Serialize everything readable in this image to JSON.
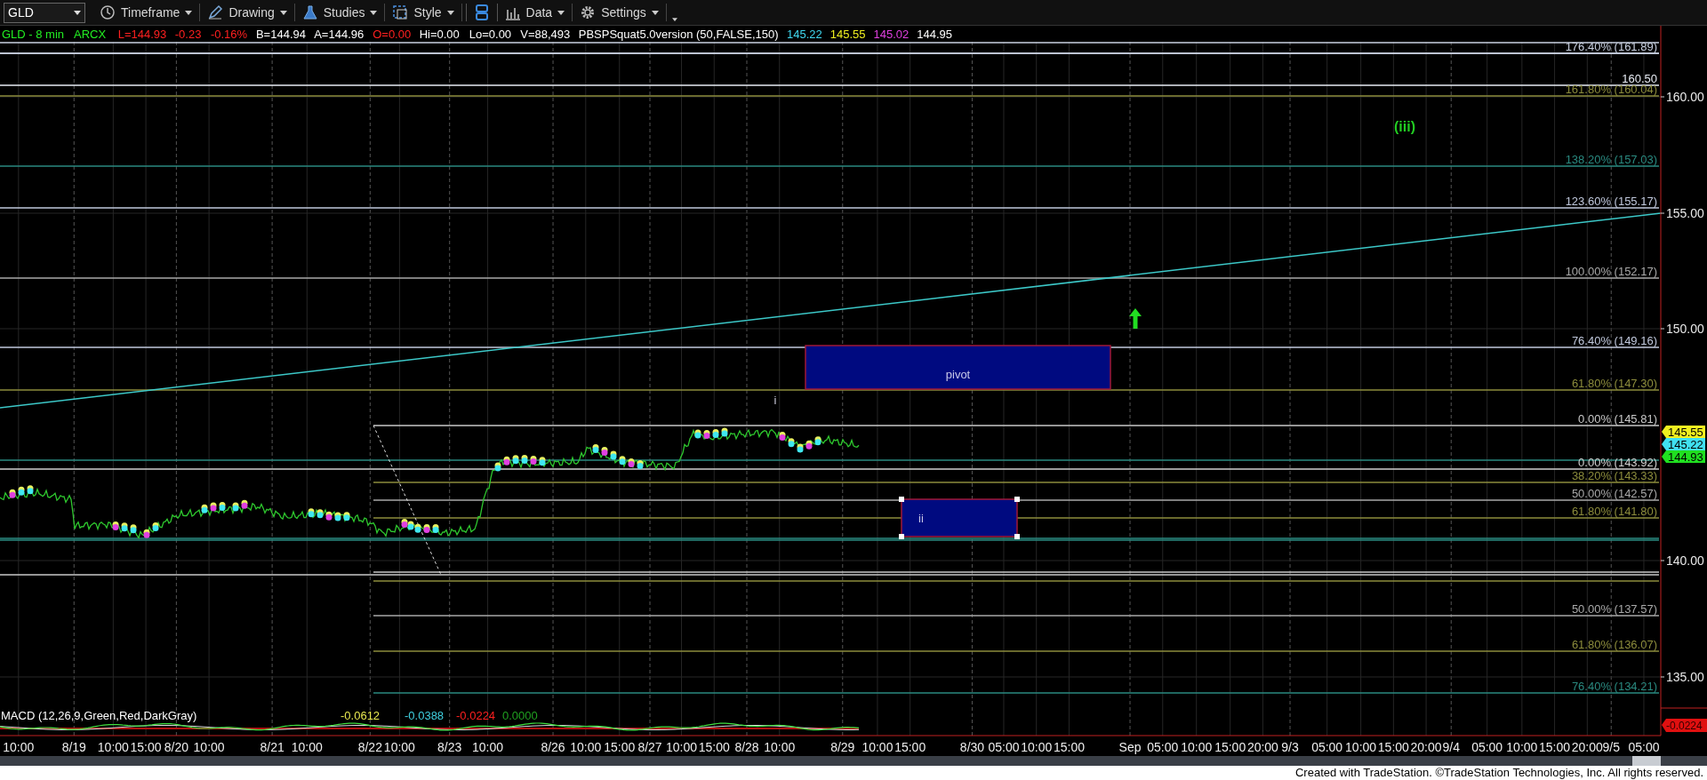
{
  "toolbar": {
    "symbol": "GLD",
    "buttons": [
      {
        "kind": "timeframe",
        "label": "Timeframe"
      },
      {
        "kind": "drawing",
        "label": "Drawing"
      },
      {
        "kind": "studies",
        "label": "Studies"
      },
      {
        "kind": "style",
        "label": "Style"
      },
      {
        "kind": "layout"
      },
      {
        "kind": "data",
        "label": "Data"
      },
      {
        "kind": "settings",
        "label": "Settings"
      },
      {
        "kind": "more"
      }
    ]
  },
  "info_line": [
    {
      "text": "GLD - 8 min",
      "color": "#22ee22"
    },
    {
      "text": "ARCX",
      "color": "#22ee22"
    },
    {
      "text": "L=144.93",
      "color": "#ff2020"
    },
    {
      "text": "-0.23",
      "color": "#ff2020"
    },
    {
      "text": "-0.16%",
      "color": "#ff2020"
    },
    {
      "text": "B=144.94",
      "color": "#ffffff"
    },
    {
      "text": "A=144.96",
      "color": "#ffffff"
    },
    {
      "text": "O=0.00",
      "color": "#ff2020"
    },
    {
      "text": "Hi=0.00",
      "color": "#ffffff"
    },
    {
      "text": "Lo=0.00",
      "color": "#ffffff"
    },
    {
      "text": "V=88,493",
      "color": "#ffffff"
    },
    {
      "text": "PBSPSquat5.0version (50,FALSE,150)",
      "color": "#ffffff"
    },
    {
      "text": "145.22",
      "color": "#40d8f0"
    },
    {
      "text": "145.55",
      "color": "#f0f020"
    },
    {
      "text": "145.02",
      "color": "#e040e0"
    },
    {
      "text": "144.95",
      "color": "#ffffff"
    }
  ],
  "fib_levels": [
    {
      "label": "176.40% (161.89)",
      "color": "#c8d0e0"
    },
    {
      "label": "160.50",
      "color": "#e8ecf4"
    },
    {
      "label": "161.80% (160.04)",
      "color": "#8c8c3c"
    },
    {
      "label": "138.20% (157.03)",
      "color": "#2a8a80"
    },
    {
      "label": "123.60% (155.17)",
      "color": "#c0c8dc"
    },
    {
      "label": "100.00% (152.17)",
      "color": "#a8a8a8"
    },
    {
      "label": "76.40% (149.16)",
      "color": "#c0c8dc"
    },
    {
      "label": "61.80% (147.30)",
      "color": "#8c8c3c"
    },
    {
      "label": "0.00% (145.81)",
      "color": "#c8c8c8"
    },
    {
      "label": "0.00% (143.92)",
      "color": "#d0d0d0"
    },
    {
      "label": "38.20% (143.33)",
      "color": "#8c8c3c"
    },
    {
      "label": "50.00% (142.57)",
      "color": "#a8a8a8"
    },
    {
      "label": "61.80% (141.80)",
      "color": "#8c8c3c"
    },
    {
      "label": "50.00% (137.57)",
      "color": "#a8a8a8"
    },
    {
      "label": "61.80% (136.07)",
      "color": "#8c8c3c"
    },
    {
      "label": "76.40% (134.21)",
      "color": "#2a8a80"
    }
  ],
  "price_axis": [
    "160.00",
    "155.00",
    "150.00",
    "140.00",
    "135.00"
  ],
  "price_badges": [
    {
      "text": "145.55",
      "color": "#f0f020"
    },
    {
      "text": "145.22",
      "color": "#40e0f0"
    },
    {
      "text": "144.93",
      "color": "#20e020"
    }
  ],
  "annotations": [
    {
      "kind": "wave-label",
      "text": "(iii)"
    },
    {
      "kind": "up-arrow"
    },
    {
      "kind": "zone",
      "text": "pivot"
    },
    {
      "kind": "wave-label",
      "text": "i"
    },
    {
      "kind": "zone",
      "text": "ii"
    }
  ],
  "macd": {
    "label": "MACD (12,26,9,Green,Red,DarkGray)",
    "values": [
      {
        "text": "-0.0612",
        "color": "#e8e850"
      },
      {
        "text": "-0.0388",
        "color": "#40d0e0"
      },
      {
        "text": "-0.0224",
        "color": "#ff2020"
      },
      {
        "text": "0.0000",
        "color": "#20a020"
      }
    ],
    "badge": "-0.0224"
  },
  "time_axis": [
    "10:00",
    "8/19",
    "10:00",
    "15:00",
    "8/20",
    "10:00",
    "8/21",
    "10:00",
    "8/22",
    "10:00",
    "8/23",
    "10:00",
    "8/26",
    "10:00",
    "15:00",
    "8/27",
    "10:00",
    "15:00",
    "8/28",
    "10:00",
    "8/29",
    "10:00",
    "15:00",
    "8/30",
    "05:00",
    "10:00",
    "15:00",
    "Sep",
    "05:00",
    "10:00",
    "15:00",
    "20:00",
    "9/3",
    "05:00",
    "10:00",
    "15:00",
    "20:00",
    "9/4",
    "05:00",
    "10:00",
    "15:00",
    "20:00",
    "9/5",
    "05:00"
  ],
  "footer": "Created with TradeStation. ©TradeStation Technologies, Inc. All rights reserved."
}
